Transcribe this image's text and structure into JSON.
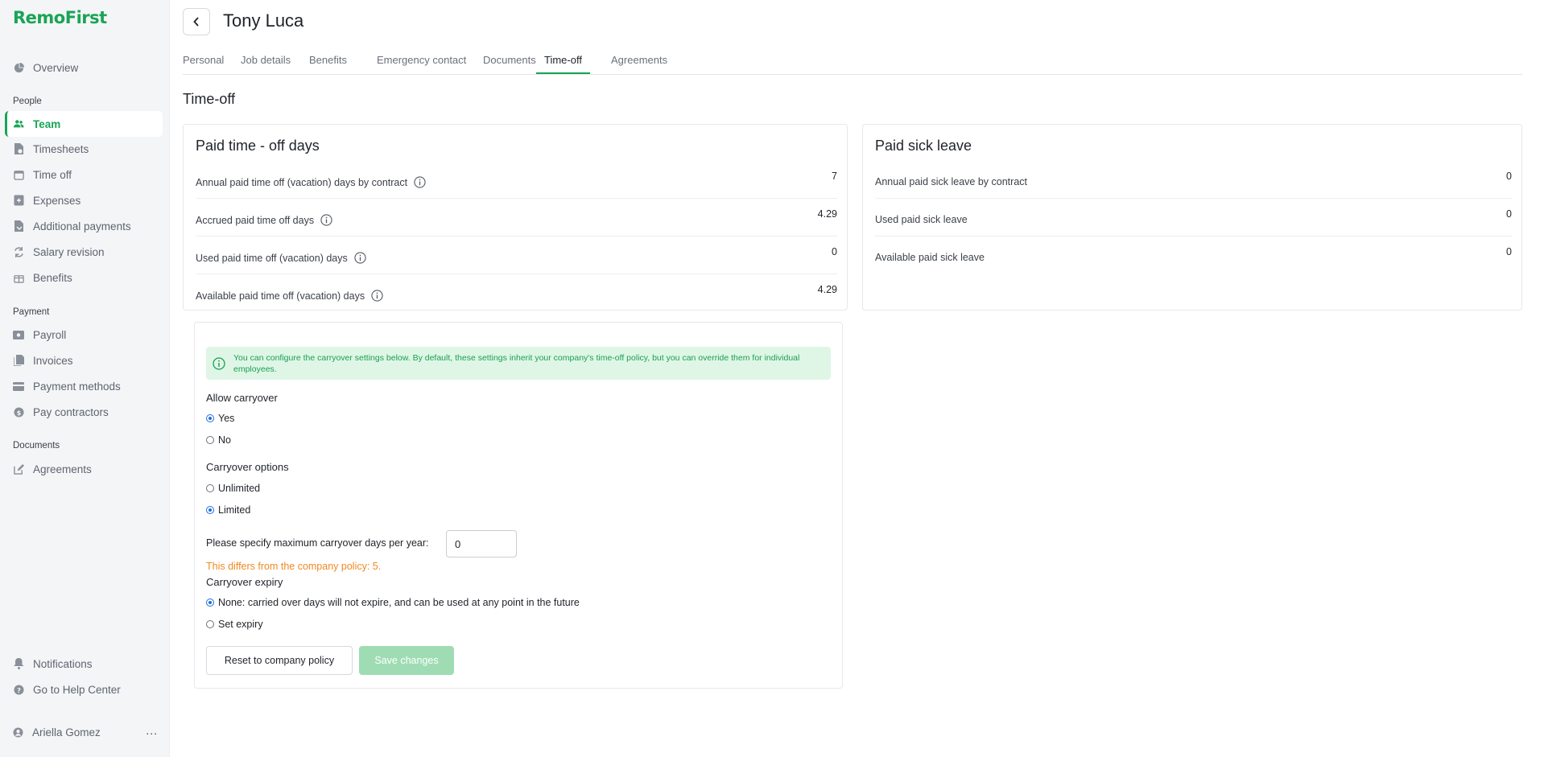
{
  "app": {
    "logo": "RemoFirst"
  },
  "sidebar": {
    "top_items": [
      {
        "label": "Overview",
        "icon": "pie-chart-icon"
      }
    ],
    "sections": [
      {
        "label": "People",
        "items": [
          {
            "label": "Team",
            "icon": "users-icon",
            "active": true
          },
          {
            "label": "Timesheets",
            "icon": "timesheet-icon"
          },
          {
            "label": "Time off",
            "icon": "calendar-icon"
          },
          {
            "label": "Expenses",
            "icon": "receipt-icon"
          },
          {
            "label": "Additional payments",
            "icon": "payments-icon"
          },
          {
            "label": "Salary revision",
            "icon": "refresh-icon"
          },
          {
            "label": "Benefits",
            "icon": "gift-icon"
          }
        ]
      },
      {
        "label": "Payment",
        "items": [
          {
            "label": "Payroll",
            "icon": "payroll-icon"
          },
          {
            "label": "Invoices",
            "icon": "invoice-icon"
          },
          {
            "label": "Payment methods",
            "icon": "card-icon"
          },
          {
            "label": "Pay contractors",
            "icon": "dollar-icon"
          }
        ]
      },
      {
        "label": "Documents",
        "items": [
          {
            "label": "Agreements",
            "icon": "edit-icon"
          }
        ]
      }
    ],
    "bottom_items": [
      {
        "label": "Notifications",
        "icon": "bell-icon"
      },
      {
        "label": "Go to Help Center",
        "icon": "help-icon"
      }
    ],
    "user": {
      "name": "Ariella Gomez",
      "more": "..."
    }
  },
  "header": {
    "employee_name": "Tony Luca"
  },
  "tabs": [
    {
      "label": "Personal"
    },
    {
      "label": "Job details"
    },
    {
      "label": "Benefits"
    },
    {
      "label": "Emergency contact"
    },
    {
      "label": "Documents"
    },
    {
      "label": "Time-off",
      "active": true
    },
    {
      "label": "Agreements"
    }
  ],
  "page": {
    "title": "Time-off"
  },
  "pto": {
    "title": "Paid time - off days",
    "rows": [
      {
        "label": "Annual paid time off (vacation) days by contract",
        "value": "7"
      },
      {
        "label": "Accrued paid time off days",
        "value": "4.29"
      },
      {
        "label": "Used paid time off (vacation) days",
        "value": "0"
      },
      {
        "label": "Available paid time off (vacation) days",
        "value": "4.29"
      }
    ]
  },
  "sick": {
    "title": "Paid sick leave",
    "rows": [
      {
        "label": "Annual paid sick leave by contract",
        "value": "0"
      },
      {
        "label": "Used paid sick leave",
        "value": "0"
      },
      {
        "label": "Available paid sick leave",
        "value": "0"
      }
    ]
  },
  "carryover": {
    "alert": "You can configure the carryover settings below. By default, these settings inherit your company's time-off policy, but you can override them for individual employees.",
    "allow_label": "Allow carryover",
    "allow_options": [
      {
        "label": "Yes",
        "checked": true
      },
      {
        "label": "No",
        "checked": false
      }
    ],
    "options_label": "Carryover options",
    "options": [
      {
        "label": "Unlimited",
        "checked": false
      },
      {
        "label": "Limited",
        "checked": true
      }
    ],
    "max_label": "Please specify maximum carryover days per year:",
    "max_value": "0",
    "warning": "This differs from the company policy: 5.",
    "expiry_label": "Carryover expiry",
    "expiry_options": [
      {
        "label": "None: carried over days will not expire, and can be used at any point in the future",
        "checked": true
      },
      {
        "label": "Set expiry",
        "checked": false
      }
    ],
    "reset_label": "Reset to company policy",
    "save_label": "Save changes"
  },
  "colors": {
    "brand": "#19a456",
    "alert_bg": "#dff6e6",
    "warning": "#f08a24",
    "save_disabled": "#9fdcb3"
  }
}
